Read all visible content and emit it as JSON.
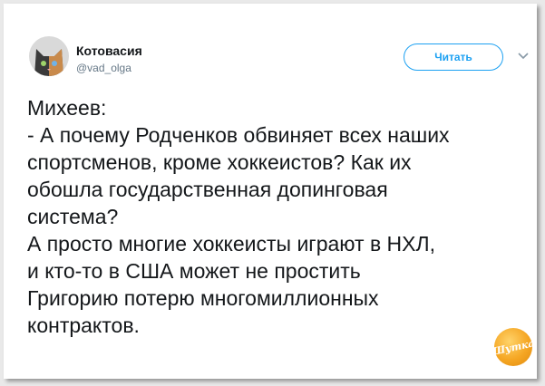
{
  "author": {
    "display_name": "Котовасия",
    "handle": "@vad_olga",
    "avatar_icon": "cat-avatar-icon"
  },
  "follow_button": {
    "label": "Читать"
  },
  "menu": {
    "icon": "chevron-down-icon"
  },
  "tweet": {
    "lines": [
      "Михеев:",
      "- А почему Родченков обвиняет всех наших",
      "спортсменов, кроме хоккеистов? Как их",
      "обошла государственная допинговая",
      "система?",
      "А просто многие хоккеисты играют в НХЛ,",
      "и кто-то в США может не простить",
      "Григорию потерю многомиллионных",
      "контрактов."
    ]
  },
  "watermark": {
    "text": "Шутка"
  },
  "colors": {
    "accent": "#1da1f2",
    "text": "#14171a",
    "muted": "#657786",
    "watermark": "#f5a623"
  }
}
